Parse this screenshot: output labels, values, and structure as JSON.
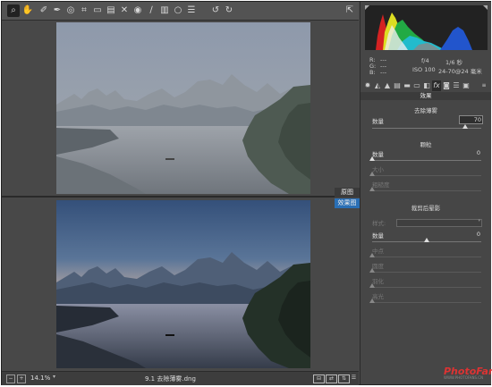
{
  "toolbar": {
    "tools": [
      {
        "icon": "zoom-icon",
        "glyph": "⌕"
      },
      {
        "icon": "hand-icon",
        "glyph": "✋"
      },
      {
        "icon": "white-balance-icon",
        "glyph": "✐"
      },
      {
        "icon": "color-sampler-icon",
        "glyph": "✒"
      },
      {
        "icon": "targeted-adjustment-icon",
        "glyph": "◎"
      },
      {
        "icon": "crop-icon",
        "glyph": "⌗"
      },
      {
        "icon": "straighten-icon",
        "glyph": "▭"
      },
      {
        "icon": "transform-icon",
        "glyph": "▤"
      },
      {
        "icon": "spot-removal-icon",
        "glyph": "✕"
      },
      {
        "icon": "red-eye-icon",
        "glyph": "◉"
      },
      {
        "icon": "adjustment-brush-icon",
        "glyph": "∕"
      },
      {
        "icon": "graduated-filter-icon",
        "glyph": "▥"
      },
      {
        "icon": "radial-filter-icon",
        "glyph": "○"
      },
      {
        "icon": "preferences-icon",
        "glyph": "☰"
      },
      {
        "icon": "rotate-left-icon",
        "glyph": "↺"
      },
      {
        "icon": "rotate-right-icon",
        "glyph": "↻"
      }
    ]
  },
  "preview": {
    "tag_before": "原图",
    "tag_after": "效果图"
  },
  "statusbar": {
    "zoom": "14.1%",
    "filename": "9.1 去除薄雾.dng"
  },
  "info": {
    "r": "R:",
    "g": "G:",
    "b": "B:",
    "r_val": "---",
    "g_val": "---",
    "b_val": "---",
    "aperture": "f/4",
    "shutter": "1/6 秒",
    "iso": "ISO 100",
    "lens": "24-70@24 毫米"
  },
  "panel": {
    "title": "效果",
    "dehaze": {
      "title": "去除薄雾",
      "amount_label": "数量",
      "amount_value": "70",
      "amount": 70
    },
    "grain": {
      "title": "颗粒",
      "amount_label": "数量",
      "amount_value": "0",
      "size_label": "大小",
      "roughness_label": "粗糙度"
    },
    "vignette": {
      "title": "裁剪后晕影",
      "style_label": "样式:",
      "amount_label": "数量",
      "amount_value": "0",
      "midpoint_label": "中点",
      "roundness_label": "圆度",
      "feather_label": "羽化",
      "highlights_label": "高光"
    }
  },
  "watermark": {
    "brand": "PhotoFans",
    "site": "WWW.PHOTOFANS.CN"
  },
  "colors": {
    "accent": "#2a6fb5",
    "panel_bg": "#464646",
    "histogram_bg": "#222222"
  }
}
